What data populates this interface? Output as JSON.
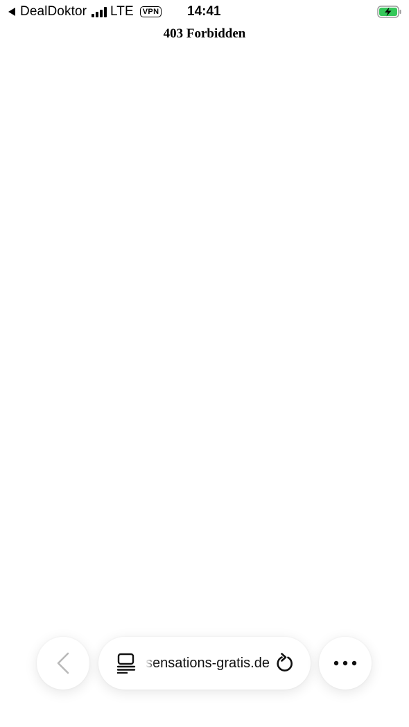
{
  "status_bar": {
    "back_app_label": "DealDoktor",
    "network_label": "LTE",
    "vpn_label": "VPN",
    "time": "14:41",
    "battery_state": "charging",
    "accent_color": "#34c759"
  },
  "page": {
    "heading": "403 Forbidden"
  },
  "toolbar": {
    "url": "sensations-gratis.de",
    "back_icon": "chevron-left-icon",
    "reader_icon": "reader-mode-icon",
    "reload_icon": "reload-icon",
    "more_icon": "more-dots-icon"
  }
}
